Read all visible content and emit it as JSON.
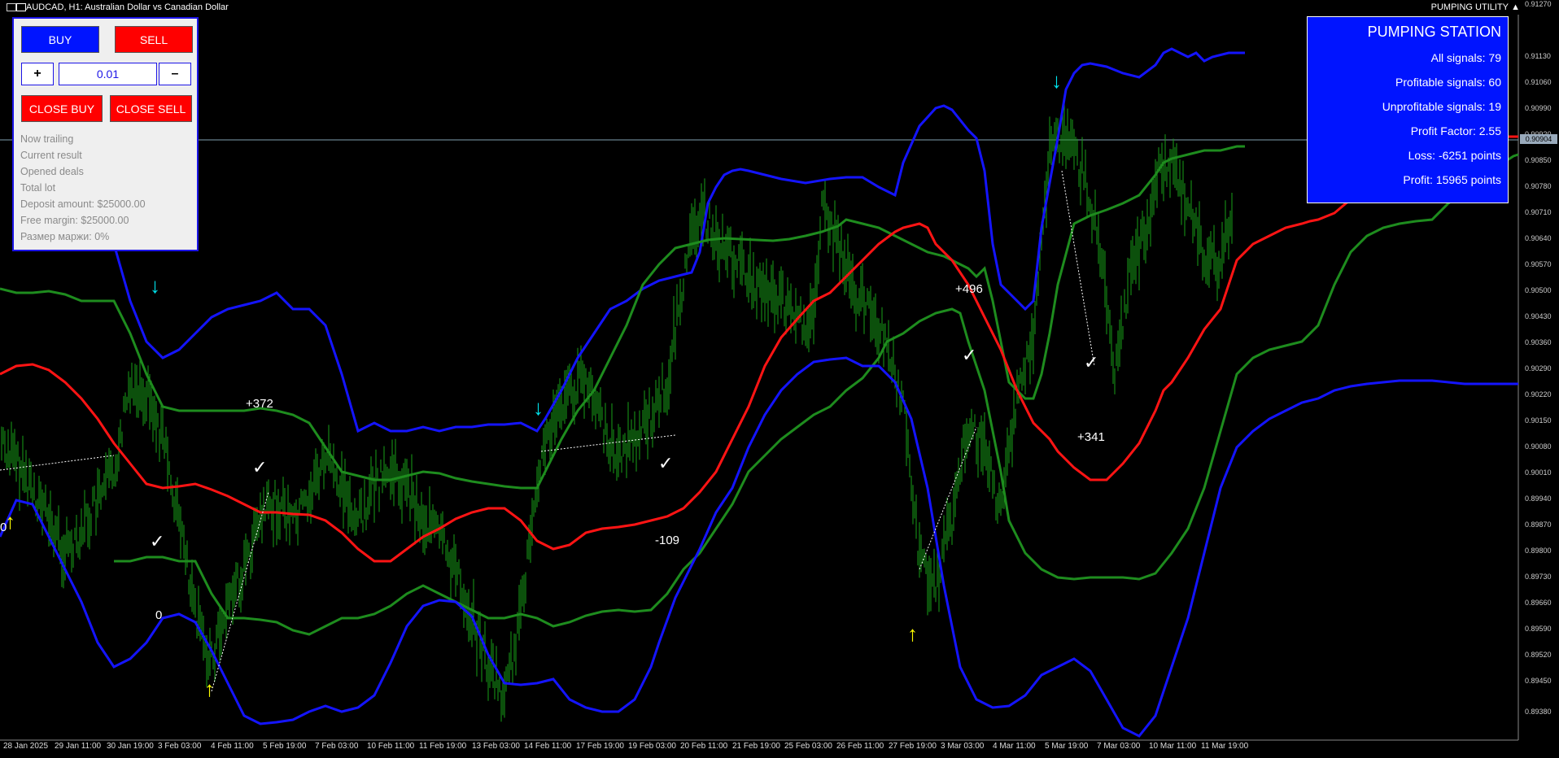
{
  "titlebar": {
    "title": "AUDCAD, H1:  Australian Dollar vs Canadian Dollar",
    "utility": "PUMPING UTILITY"
  },
  "panel": {
    "buy": "BUY",
    "sell": "SELL",
    "plus": "+",
    "minus": "–",
    "lot": "0.01",
    "close_buy": "CLOSE BUY",
    "close_sell": "CLOSE SELL",
    "info": [
      "Now trailing",
      "Current result",
      "Opened deals",
      "Total lot",
      "Deposit amount: $25000.00",
      "Free margin: $25000.00",
      "Размер маржи: 0%"
    ]
  },
  "stats": {
    "title": "PUMPING STATION",
    "rows": [
      "All signals:  79",
      "Profitable signals:  60",
      "Unprofitable signals:  19",
      "Profit Factor:  2.55",
      "Loss:  -6251 points",
      "Profit:  15965 points"
    ]
  },
  "price_axis": [
    "0.91270",
    "0.91130",
    "0.91060",
    "0.90990",
    "0.90920",
    "0.90850",
    "0.90780",
    "0.90710",
    "0.90640",
    "0.90570",
    "0.90500",
    "0.90430",
    "0.90360",
    "0.90290",
    "0.90220",
    "0.90150",
    "0.90080",
    "0.90010",
    "0.89940",
    "0.89870",
    "0.89800",
    "0.89730",
    "0.89660",
    "0.89590",
    "0.89520",
    "0.89450",
    "0.89380"
  ],
  "current_price": "0.90904",
  "time_axis": [
    "28 Jan 2025",
    "29 Jan 11:00",
    "30 Jan 19:00",
    "3 Feb 03:00",
    "4 Feb 11:00",
    "5 Feb 19:00",
    "7 Feb 03:00",
    "10 Feb 11:00",
    "11 Feb 19:00",
    "13 Feb 03:00",
    "14 Feb 11:00",
    "17 Feb 19:00",
    "19 Feb 03:00",
    "20 Feb 11:00",
    "21 Feb 19:00",
    "25 Feb 03:00",
    "26 Feb 11:00",
    "27 Feb 19:00",
    "3 Mar 03:00",
    "4 Mar 11:00",
    "5 Mar 19:00",
    "7 Mar 03:00",
    "10 Mar 11:00",
    "11 Mar 19:00"
  ],
  "trade_labels": [
    "+372",
    "0",
    "-109",
    "+496",
    "+341",
    "0"
  ],
  "colors": {
    "outer_band": "#1414ff",
    "inner_band": "#1e8c1e",
    "mid_line": "#ff1414",
    "price_bars": "#19a019",
    "buy_arrow": "#ffff00",
    "sell_arrow": "#00e5ee",
    "panel_border": "#1c14e6"
  },
  "chart_data": {
    "type": "line",
    "symbol": "AUDCAD",
    "timeframe": "H1",
    "x_range": [
      "28 Jan 2025",
      "11 Mar 19:00"
    ],
    "y_range": [
      0.8934,
      0.9127
    ],
    "current_price": 0.90904,
    "series": [
      {
        "values_y": [
          0.9004,
          0.9,
          0.8995,
          0.899,
          0.8985,
          0.8975,
          0.897,
          0.899,
          0.902,
          0.903,
          0.9025,
          0.902,
          0.9022,
          0.9035,
          0.903,
          0.9045,
          0.9055,
          0.906,
          0.9058,
          0.907,
          0.91,
          0.9105,
          0.909,
          0.9095,
          0.908,
          0.9098
        ]
      },
      {
        "values_y": [
          0.898,
          0.8985,
          0.899,
          0.8992,
          0.8985,
          0.898,
          0.8985,
          0.8975,
          0.8985,
          0.899,
          0.9,
          0.902,
          0.9045,
          0.906,
          0.9062,
          0.9055,
          0.9035,
          0.903,
          0.901,
          0.9005,
          0.9015,
          0.903,
          0.905,
          0.9068,
          0.9067
        ]
      },
      {
        "values_y": [
          0.8955,
          0.895,
          0.8962,
          0.8958,
          0.8945,
          0.8938,
          0.8945,
          0.896,
          0.8962,
          0.895,
          0.8945,
          0.8955,
          0.897,
          0.899,
          0.901,
          0.903,
          0.9045,
          0.902,
          0.8965,
          0.8945,
          0.895,
          0.8935,
          0.8955,
          0.9,
          0.9022
        ]
      }
    ]
  }
}
